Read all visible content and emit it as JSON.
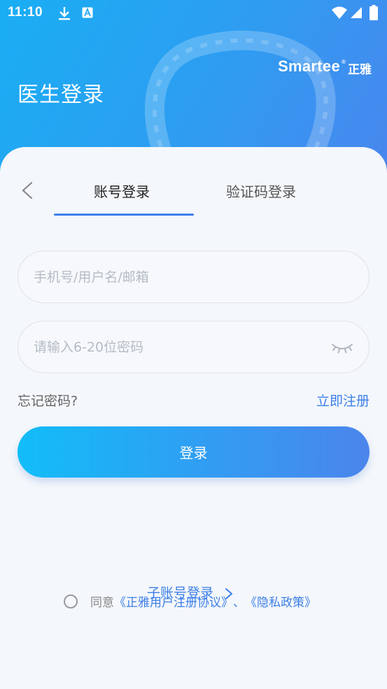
{
  "status_bar": {
    "time": "11:10",
    "icons": [
      "download-icon",
      "a-badge-icon",
      "wifi-icon",
      "signal-icon",
      "battery-icon"
    ]
  },
  "brand": {
    "name_en": "Smartee",
    "registered": "®",
    "name_cn": "正雅"
  },
  "page": {
    "title": "医生登录"
  },
  "tabs": [
    {
      "label": "账号登录",
      "active": true
    },
    {
      "label": "验证码登录",
      "active": false
    }
  ],
  "form": {
    "username_placeholder": "手机号/用户名/邮箱",
    "username_value": "",
    "password_placeholder": "请输入6-20位密码",
    "password_value": "",
    "forgot_label": "忘记密码?",
    "register_label": "立即注册",
    "login_label": "登录"
  },
  "sub_account": {
    "label": "子账号登录"
  },
  "agreement": {
    "prefix": "同意",
    "terms_link": "《正雅用户注册协议》",
    "separator": "、",
    "privacy_link": "《隐私政策》"
  },
  "colors": {
    "accent": "#3d7fe8",
    "header_start": "#19aef4",
    "header_end": "#4a86ee",
    "background": "#f4f7fb"
  }
}
